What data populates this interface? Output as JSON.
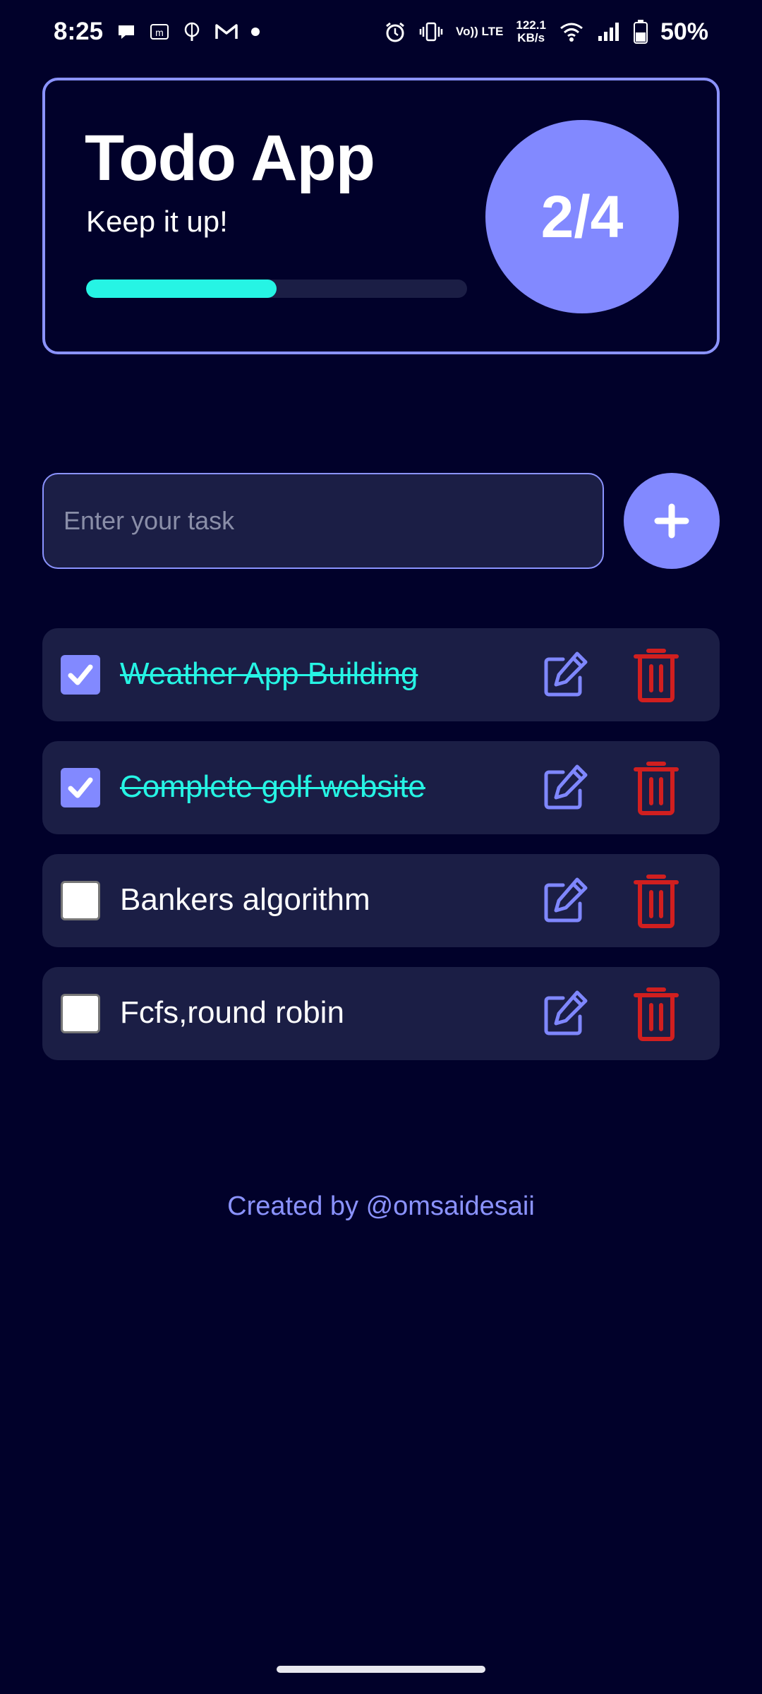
{
  "status_bar": {
    "time": "8:25",
    "speed_value": "122.1",
    "speed_unit": "KB/s",
    "volte_label": "Vo)) LTE",
    "battery_text": "50%",
    "left_icons": [
      "chat-bubble-icon",
      "m-app-icon",
      "brain-icon",
      "gmail-icon",
      "notification-dot-icon"
    ],
    "right_icons": [
      "alarm-icon",
      "vibrate-icon",
      "volte-icon",
      "wifi-icon",
      "signal-icon",
      "battery-icon"
    ]
  },
  "header": {
    "title": "Todo App",
    "subtitle": "Keep it up!",
    "completed": 2,
    "total": 4,
    "counter_text": "2/4",
    "progress_fraction": 0.5
  },
  "input": {
    "placeholder": "Enter your task",
    "value": "",
    "add_icon": "plus-icon"
  },
  "tasks": [
    {
      "text": "Weather App Building",
      "done": true
    },
    {
      "text": "Complete golf website",
      "done": true
    },
    {
      "text": "Bankers algorithm",
      "done": false
    },
    {
      "text": "Fcfs,round robin",
      "done": false
    }
  ],
  "footer": {
    "credit": "Created by @omsaidesaii"
  },
  "colors": {
    "background": "#01012a",
    "card": "#1b1e45",
    "accent": "#8289ff",
    "done_text": "#26f4e4",
    "delete": "#d11f1f"
  }
}
